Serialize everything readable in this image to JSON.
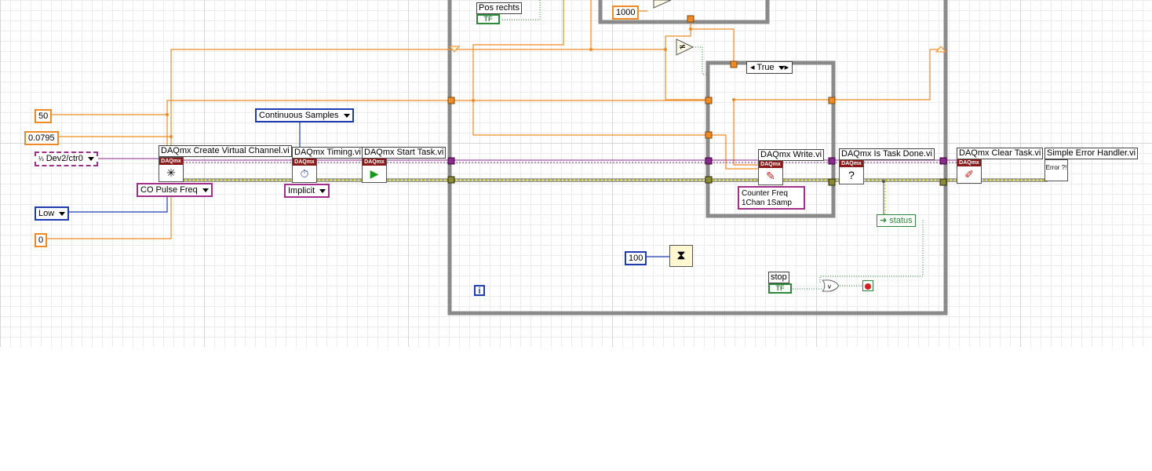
{
  "constants": {
    "fifty": "50",
    "duty": "0.0795",
    "zero": "0",
    "thousand": "1000",
    "hundred": "100"
  },
  "channel": "Dev2/ctr0",
  "enums": {
    "sample_mode": "Continuous Samples",
    "co_type": "CO Pulse Freq",
    "idle_state": "Low",
    "timing_type": "Implicit",
    "write_type": "Counter Freq 1Chan 1Samp",
    "write_type_line1": "Counter Freq",
    "write_type_line2": "1Chan 1Samp"
  },
  "vi_labels": {
    "create_channel": "DAQmx Create Virtual Channel.vi",
    "timing": "DAQmx Timing.vi",
    "start_task": "DAQmx Start Task.vi",
    "write": "DAQmx Write.vi",
    "is_task_done": "DAQmx Is Task Done.vi",
    "clear_task": "DAQmx Clear Task.vi",
    "error_handler": "Simple Error Handler.vi"
  },
  "terminals": {
    "pos_rechts": "Pos rechts",
    "stop": "stop",
    "status": "status",
    "bool_glyph": "TF"
  },
  "case_structure": {
    "selector": "True"
  },
  "loop": {
    "iteration_glyph": "i"
  },
  "icons": {
    "daqmx_header": "DAQmx",
    "error_text": "Error ?!"
  },
  "colors": {
    "integer_wire": "#1f3db0",
    "double_wire": "#f08a24",
    "task_wire": "#8a2a8a",
    "error_wire": "#bcbc2a",
    "boolean_wire": "#2d8a3a",
    "structure_frame": "#808080"
  }
}
